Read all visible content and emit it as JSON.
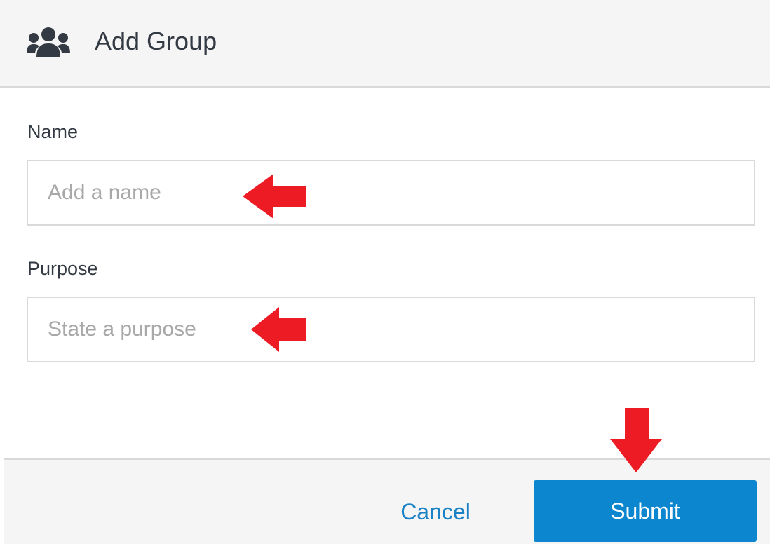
{
  "dialog": {
    "title": "Add Group",
    "icon": "users-group-icon"
  },
  "form": {
    "name": {
      "label": "Name",
      "placeholder": "Add a name",
      "value": ""
    },
    "purpose": {
      "label": "Purpose",
      "placeholder": "State a purpose",
      "value": ""
    }
  },
  "footer": {
    "cancel_label": "Cancel",
    "submit_label": "Submit"
  },
  "annotations": {
    "arrow_color": "#ed1c24",
    "arrows": [
      "arrow-left-icon",
      "arrow-left-icon",
      "arrow-down-icon"
    ]
  },
  "colors": {
    "header_bg": "#f5f5f5",
    "border": "#d9d9d9",
    "text": "#333a43",
    "placeholder": "#a8a8a8",
    "link": "#1b82c6",
    "primary": "#0b86cf"
  }
}
